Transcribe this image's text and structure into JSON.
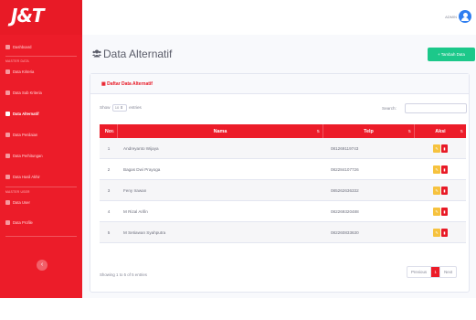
{
  "brand": {
    "logo_text": "J&T"
  },
  "topbar": {
    "user_name": "ADMIN"
  },
  "sidebar": {
    "items": [
      {
        "label": "Dashboard",
        "icon": "dashboard-icon",
        "active": false
      },
      {
        "label": "Data Kriteria",
        "icon": "criteria-icon",
        "active": false
      },
      {
        "label": "Data Sub Kriteria",
        "icon": "subcriteria-icon",
        "active": false
      },
      {
        "label": "Data Alternatif",
        "icon": "users-icon",
        "active": true
      },
      {
        "label": "Data Penilaian",
        "icon": "edit-icon",
        "active": false
      },
      {
        "label": "Data Perhitungan",
        "icon": "calculator-icon",
        "active": false
      },
      {
        "label": "Data Hasil Akhir",
        "icon": "chart-icon",
        "active": false
      },
      {
        "label": "Data User",
        "icon": "user-icon",
        "active": false
      },
      {
        "label": "Data Profile",
        "icon": "profile-icon",
        "active": false
      }
    ],
    "headings": [
      "MASTER DATA",
      "MASTER USER"
    ]
  },
  "page": {
    "title": "Data Alternatif",
    "add_button": "+ Tambah Data"
  },
  "card": {
    "title": "Daftar Data Alternatif",
    "show_prefix": "Show",
    "show_value": "10",
    "show_suffix": "entries",
    "search_label": "Search:"
  },
  "table": {
    "columns": [
      "No",
      "Nama",
      "Telp",
      "Aksi"
    ],
    "rows": [
      {
        "no": "1",
        "nama": "Andreyanto Wijaya",
        "telp": "081269119743"
      },
      {
        "no": "2",
        "nama": "Bagas Dwi Prayoga",
        "telp": "082284107726"
      },
      {
        "no": "3",
        "nama": "Feny Irawan",
        "telp": "085262636332"
      },
      {
        "no": "4",
        "nama": "M Rizal Arifin",
        "telp": "082269320488"
      },
      {
        "no": "5",
        "nama": "M Setiawan Syahputra",
        "telp": "082260833630"
      }
    ]
  },
  "footer": {
    "info": "Showing 1 to 5 of 5 entries",
    "prev": "Previous",
    "page": "1",
    "next": "Next"
  },
  "colors": {
    "primary": "#ec1c29",
    "success": "#1cc88a",
    "warning": "#f6c23e"
  }
}
